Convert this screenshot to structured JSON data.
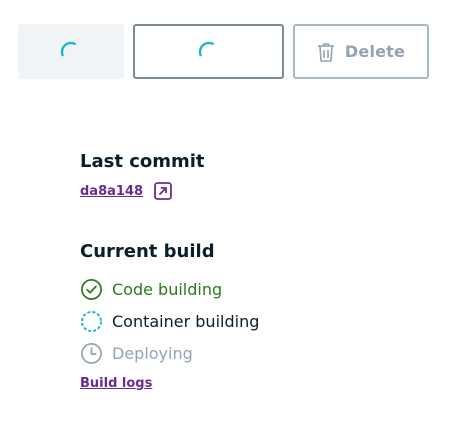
{
  "toolbar": {
    "delete_label": "Delete"
  },
  "last_commit": {
    "title": "Last commit",
    "commit_hash": "da8a148"
  },
  "current_build": {
    "title": "Current build",
    "steps": [
      {
        "label": "Code building",
        "status": "complete",
        "icon": "check-circle-icon"
      },
      {
        "label": "Container building",
        "status": "in-progress",
        "icon": "spinner-icon"
      },
      {
        "label": "Deploying",
        "status": "pending",
        "icon": "clock-icon"
      }
    ],
    "logs_link": "Build logs"
  },
  "colors": {
    "spinner": "#1fb5c4",
    "success": "#2b7a1b",
    "pending": "#95a3b0",
    "link": "#6b2c91"
  }
}
